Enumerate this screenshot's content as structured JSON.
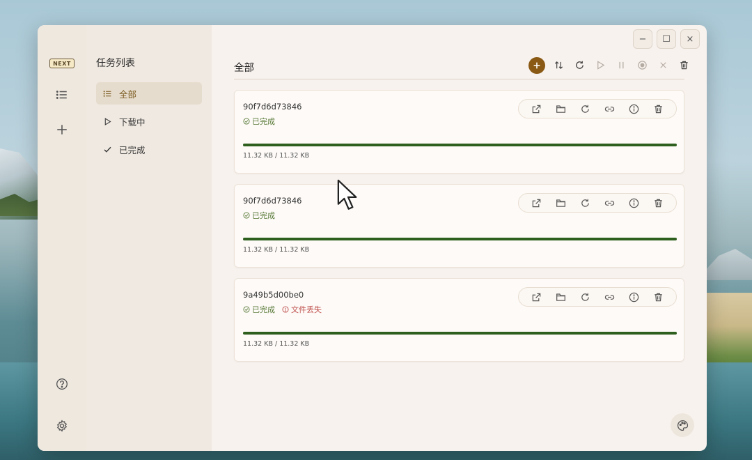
{
  "window": {
    "controls": {
      "minimize": "−",
      "maximize": "☐",
      "close": "×"
    }
  },
  "rail": {
    "logo": "NEXT",
    "items": [
      {
        "name": "task-list",
        "icon": "list-icon"
      },
      {
        "name": "add-task",
        "icon": "plus-icon"
      }
    ],
    "bottom": [
      {
        "name": "help",
        "icon": "help-icon"
      },
      {
        "name": "settings",
        "icon": "gear-icon"
      }
    ]
  },
  "sidebar": {
    "title": "任务列表",
    "items": [
      {
        "label": "全部",
        "icon": "list-icon",
        "active": true
      },
      {
        "label": "下载中",
        "icon": "play-icon",
        "active": false
      },
      {
        "label": "已完成",
        "icon": "check-icon",
        "active": false
      }
    ]
  },
  "main": {
    "title": "全部",
    "toolbar": [
      "plus-icon",
      "sort-icon",
      "refresh-icon",
      "play-icon",
      "pause-icon",
      "record-icon",
      "close-icon",
      "trash-icon"
    ]
  },
  "tasks": [
    {
      "name": "90f7d6d73846",
      "status": "已完成",
      "error": "",
      "size": "11.32 KB / 11.32 KB",
      "progress": 1.0
    },
    {
      "name": "90f7d6d73846",
      "status": "已完成",
      "error": "",
      "size": "11.32 KB / 11.32 KB",
      "progress": 1.0
    },
    {
      "name": "9a49b5d00be0",
      "status": "已完成",
      "error": "文件丢失",
      "size": "11.32 KB / 11.32 KB",
      "progress": 1.0
    }
  ],
  "card_actions": [
    "open-external-icon",
    "folder-icon",
    "refresh-icon",
    "link-icon",
    "info-icon",
    "trash-icon"
  ],
  "colors": {
    "accent": "#8a5a14",
    "progress": "#2f5f1f",
    "ok": "#597a38",
    "error": "#c0504d"
  }
}
